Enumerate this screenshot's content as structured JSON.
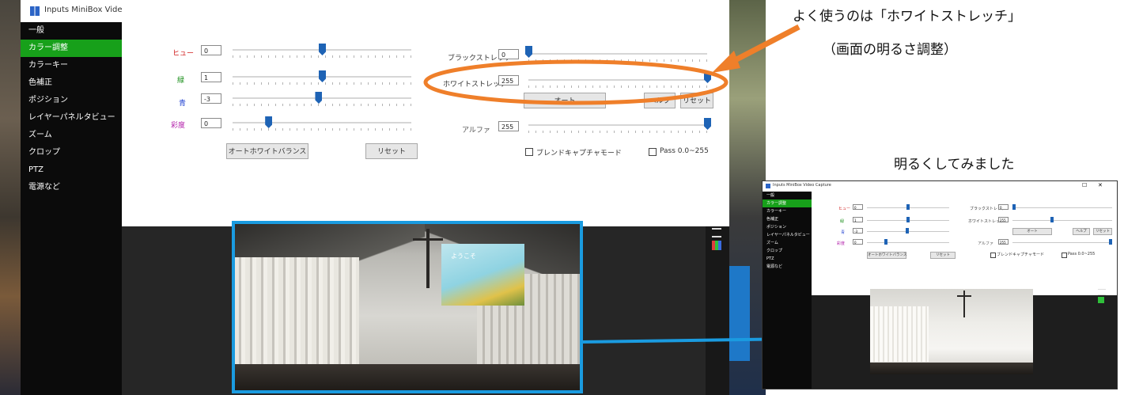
{
  "window": {
    "title": "Inputs MiniBox Video Capture",
    "minimize": "—",
    "maximize": "☐",
    "close": "✕"
  },
  "sidebar": {
    "items": [
      {
        "label": "一般"
      },
      {
        "label": "カラー調整"
      },
      {
        "label": "カラーキー"
      },
      {
        "label": "色補正"
      },
      {
        "label": "ポジション"
      },
      {
        "label": "レイヤーパネルタビュー"
      },
      {
        "label": "ズーム"
      },
      {
        "label": "クロップ"
      },
      {
        "label": "PTZ"
      },
      {
        "label": "電源など"
      }
    ]
  },
  "adjust": {
    "brightness": {
      "label": "ヒュー",
      "value": "0",
      "level": 0.5
    },
    "green": {
      "label": "緑",
      "value": "1",
      "level": 0.5
    },
    "blue": {
      "label": "青",
      "value": "-3",
      "level": 0.48
    },
    "saturation": {
      "label": "彩度",
      "value": "0",
      "level": 0.2
    },
    "auto_wb_button": "オートホワイトバランス",
    "reset_button": "リセット"
  },
  "stretch": {
    "black": {
      "label": "ブラックストレッチ",
      "value": "0",
      "level": 0.0
    },
    "white": {
      "label": "ホワイトストレッチ",
      "value": "255",
      "level": 1.0
    },
    "auto_button": "オート",
    "btn_a": "ヘルプ",
    "btn_b": "リセット",
    "alpha": {
      "label": "アルファ",
      "value": "255",
      "level": 1.0
    },
    "chk_a": "ブレンドキャプチャモード",
    "chk_b": "Pass 0.0~255"
  },
  "preview": {
    "screen_text": "ようこそ"
  },
  "annotations": {
    "top": "よく使うのは「ホワイトストレッチ」",
    "sub": "（画面の明るさ調整）",
    "bright": "明るくしてみました"
  },
  "small": {
    "stretch_white": {
      "value": "255",
      "level": 0.4
    }
  },
  "colors": {
    "highlight_ellipse": "#ef7f2a",
    "frame_blue": "#1a9be0",
    "active_green": "#17a01a",
    "thumb": "#1e63b5"
  }
}
